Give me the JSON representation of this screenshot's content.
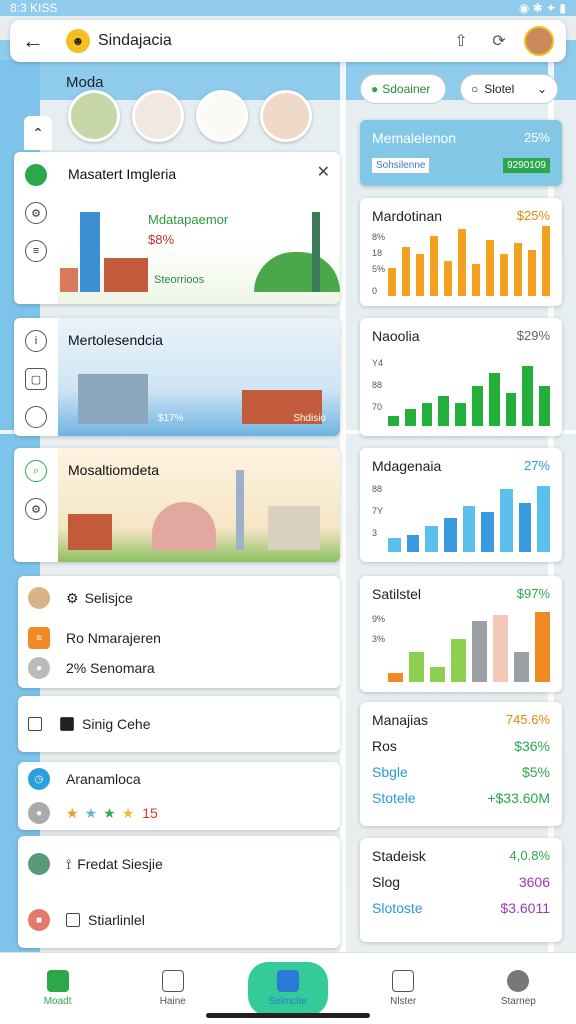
{
  "status": {
    "time": "8:3 KISS",
    "icons": "◉ ✱ ✦ ▮"
  },
  "topbar": {
    "title": "Sindajacia"
  },
  "moda_label": "Moda",
  "left": {
    "card1": {
      "title": "Masatert Imgleria",
      "overlay_title": "Mdatapaemor",
      "overlay_value": "$8%",
      "overlay_sub": "Steorrioos"
    },
    "card2": {
      "title": "Mertolesendcia",
      "badge_left": "$17%",
      "badge_right": "Shdisio"
    },
    "card3": {
      "title": "Mosaltiomdeta"
    },
    "list1": [
      "Selisjce",
      "Ro Nmarajeren",
      "2% Senomara"
    ],
    "list2": [
      "Sinig Cehe"
    ],
    "list3": {
      "title": "Aranamloca",
      "rating": "15"
    },
    "list4": [
      "Fredat Siesjie",
      "Stiarlinlel"
    ]
  },
  "right": {
    "chip1": "Sdoainer",
    "chip2": "Slotel",
    "banner": {
      "title": "Memalelenon",
      "value": "25%",
      "sub": "Sohsilenne",
      "sub2": "9290109"
    },
    "c1": {
      "title": "Mardotinan",
      "value": "$25%",
      "ticks": [
        "8%",
        "18",
        "5%",
        "0"
      ]
    },
    "c2": {
      "title": "Naoolia",
      "value": "$29%",
      "ticks": [
        "Y4",
        "88",
        "70"
      ]
    },
    "c3": {
      "title": "Mdagenaia",
      "value": "27%",
      "ticks": [
        "88",
        "7Y",
        "3"
      ]
    },
    "c4": {
      "title": "Satilstel",
      "value": "$97%",
      "ticks": [
        "9%",
        "3%"
      ]
    },
    "c5": {
      "title": "Manajias",
      "value": "745.6%",
      "rows": [
        [
          "Ros",
          "$36%"
        ],
        [
          "Sbgle",
          "$5%"
        ],
        [
          "Stotele",
          "+$33.60M"
        ]
      ]
    },
    "c6": {
      "title": "Stadeisk",
      "value": "4,0.8%",
      "rows": [
        [
          "Slog",
          "3606"
        ],
        [
          "Slotoste",
          "$3.6011"
        ]
      ]
    }
  },
  "nav": [
    "Moadt",
    "Haine",
    "Selmclar",
    "Nlster",
    "Starnep"
  ],
  "chart_data": [
    {
      "type": "bar",
      "title": "Mardotinan",
      "values": [
        8,
        14,
        12,
        17,
        10,
        19,
        9,
        16,
        12,
        15,
        13,
        20
      ]
    },
    {
      "type": "bar",
      "title": "Naoolia",
      "values": [
        3,
        5,
        7,
        9,
        7,
        12,
        16,
        10,
        18,
        12
      ]
    },
    {
      "type": "bar",
      "title": "Mdagenaia",
      "values": [
        5,
        6,
        9,
        12,
        16,
        14,
        22,
        17,
        23
      ]
    },
    {
      "type": "bar",
      "title": "Satilstel",
      "values": [
        3,
        10,
        5,
        14,
        20,
        22,
        10,
        23
      ]
    }
  ]
}
